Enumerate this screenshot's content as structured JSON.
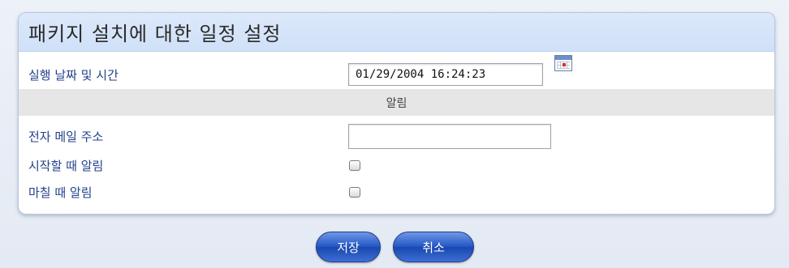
{
  "panel": {
    "title": "패키지 설치에 대한 일정 설정"
  },
  "schedule": {
    "datetime_label": "실행 날짜 및 시간",
    "datetime_value": "01/29/2004 16:24:23",
    "calendar_icon": "calendar-icon"
  },
  "notification": {
    "section_label": "알림",
    "email_label": "전자 메일 주소",
    "email_value": "",
    "notify_start_label": "시작할 때 알림",
    "notify_start_checked": false,
    "notify_end_label": "마칠 때 알림",
    "notify_end_checked": false
  },
  "buttons": {
    "save_label": "저장",
    "cancel_label": "취소"
  },
  "colors": {
    "accent": "#2458c6",
    "header_bg": "#d5e4f9",
    "label_text": "#23428a",
    "section_bg": "#e6e6e6"
  }
}
